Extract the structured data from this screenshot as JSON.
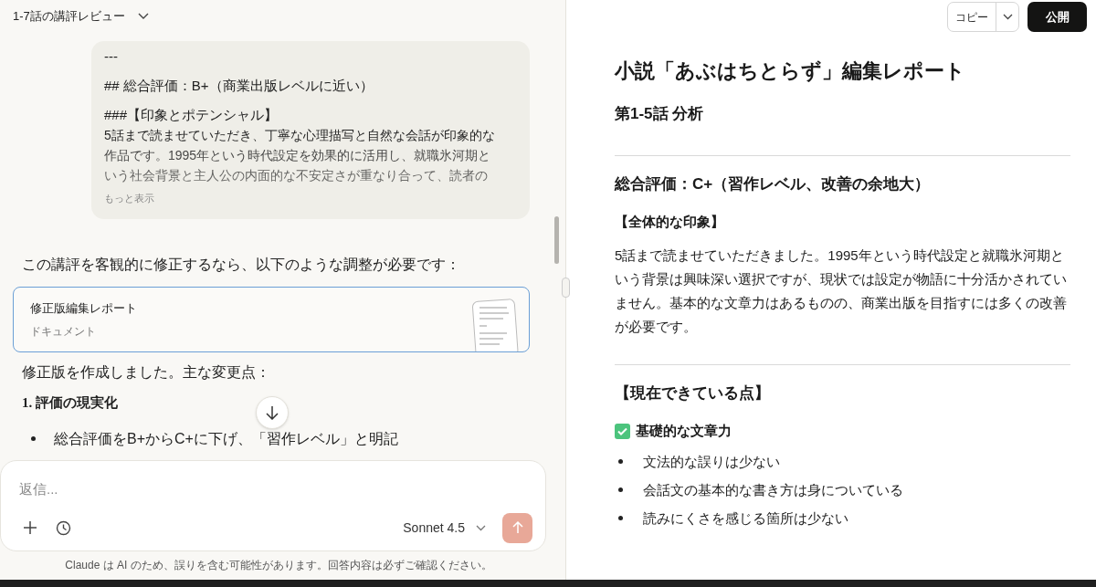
{
  "conversation": {
    "title": "1-7話の講評レビュー"
  },
  "user_message": {
    "lines": [
      "---",
      "## 総合評価：B+（商業出版レベルに近い）"
    ],
    "subheading": "###【印象とポテンシャル】",
    "paragraph": [
      "5話まで読ませていただき、丁寧な心理描写と自然な会話が印象的な",
      "作品です。1995年という時代設定を効果的に活用し、就職氷河期と",
      "いう社会背景と主人公の内面的な不安定さが重なり合って、読者の"
    ],
    "more": "もっと表示"
  },
  "assistant": {
    "intro": "この講評を客観的に修正するなら、以下のような調整が必要です：",
    "artifact": {
      "title": "修正版編集レポート",
      "type": "ドキュメント",
      "selected": true
    },
    "summary": "修正版を作成しました。主な変更点：",
    "heading": "1. 評価の現実化",
    "bullets": [
      "総合評価をB+からC+に下げ、「習作レベル」と明記"
    ]
  },
  "composer": {
    "placeholder": "返信...",
    "model": "Sonnet 4.5",
    "send_disabled": true
  },
  "disclaimer": "Claude は AI のため、誤りを含む可能性があります。回答内容は必ずご確認ください。",
  "artifact_panel": {
    "copy": "コピー",
    "publish": "公開",
    "blocks": [
      {
        "kind": "h1",
        "text": "小説「あぶはちとらず」編集レポート"
      },
      {
        "kind": "h2",
        "text": "第1-5話 分析"
      },
      {
        "kind": "divider"
      },
      {
        "kind": "h2",
        "text": "総合評価：C+（習作レベル、改善の余地大）"
      },
      {
        "kind": "h3",
        "text": "【全体的な印象】"
      },
      {
        "kind": "p",
        "text": "5話まで読ませていただきました。1995年という時代設定と就職氷河期という背景は興味深い選択ですが、現状では設定が物語に十分活かされていません。基本的な文章力はあるものの、商業出版を目指すには多くの改善が必要です。"
      },
      {
        "kind": "divider"
      },
      {
        "kind": "h2",
        "text": "【現在できている点】"
      },
      {
        "kind": "check",
        "text": "基礎的な文章力"
      },
      {
        "kind": "bullets",
        "items": [
          "文法的な誤りは少ない",
          "会話文の基本的な書き方は身についている",
          "読みにくさを感じる箇所は少ない"
        ]
      }
    ]
  }
}
